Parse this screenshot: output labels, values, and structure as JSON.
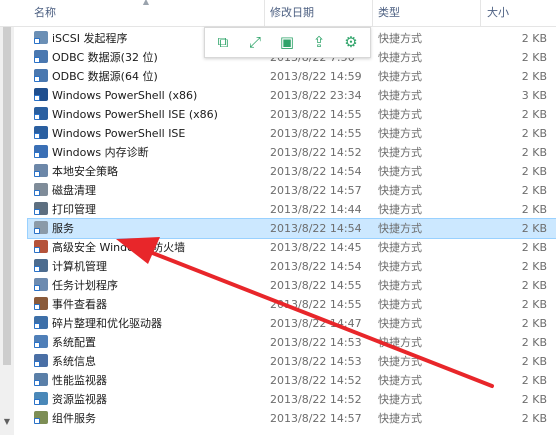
{
  "header": {
    "name_label": "名称",
    "date_label": "修改日期",
    "type_label": "类型",
    "size_label": "大小"
  },
  "toolbar": {
    "buttons": [
      {
        "name": "copy-icon",
        "glyph": "⧉"
      },
      {
        "name": "expand-icon",
        "glyph": "⤢"
      },
      {
        "name": "save-icon",
        "glyph": "▣"
      },
      {
        "name": "share-icon",
        "glyph": "⇪"
      },
      {
        "name": "gear-icon",
        "glyph": "⚙"
      }
    ]
  },
  "files": [
    {
      "name": "iSCSI 发起程序",
      "date": "",
      "type": "快捷方式",
      "size": "2 KB",
      "icon_color": "#6b8fb5",
      "selected": false
    },
    {
      "name": "ODBC 数据源(32 位)",
      "date": "2013/8/22 7:56",
      "type": "快捷方式",
      "size": "2 KB",
      "icon_color": "#4a78b0",
      "selected": false
    },
    {
      "name": "ODBC 数据源(64 位)",
      "date": "2013/8/22 14:59",
      "type": "快捷方式",
      "size": "2 KB",
      "icon_color": "#4a78b0",
      "selected": false
    },
    {
      "name": "Windows PowerShell (x86)",
      "date": "2013/8/22 23:34",
      "type": "快捷方式",
      "size": "3 KB",
      "icon_color": "#1f4f8f",
      "selected": false
    },
    {
      "name": "Windows PowerShell ISE (x86)",
      "date": "2013/8/22 14:55",
      "type": "快捷方式",
      "size": "2 KB",
      "icon_color": "#2a5fa0",
      "selected": false
    },
    {
      "name": "Windows PowerShell ISE",
      "date": "2013/8/22 14:55",
      "type": "快捷方式",
      "size": "2 KB",
      "icon_color": "#2a5fa0",
      "selected": false
    },
    {
      "name": "Windows 内存诊断",
      "date": "2013/8/22 14:52",
      "type": "快捷方式",
      "size": "2 KB",
      "icon_color": "#3a6fb5",
      "selected": false
    },
    {
      "name": "本地安全策略",
      "date": "2013/8/22 14:54",
      "type": "快捷方式",
      "size": "2 KB",
      "icon_color": "#6c87a8",
      "selected": false
    },
    {
      "name": "磁盘清理",
      "date": "2013/8/22 14:57",
      "type": "快捷方式",
      "size": "2 KB",
      "icon_color": "#7f8c99",
      "selected": false
    },
    {
      "name": "打印管理",
      "date": "2013/8/22 14:44",
      "type": "快捷方式",
      "size": "2 KB",
      "icon_color": "#5d6f80",
      "selected": false
    },
    {
      "name": "服务",
      "date": "2013/8/22 14:54",
      "type": "快捷方式",
      "size": "2 KB",
      "icon_color": "#8a9aa8",
      "selected": true
    },
    {
      "name": "高级安全 Windows 防火墙",
      "date": "2013/8/22 14:45",
      "type": "快捷方式",
      "size": "2 KB",
      "icon_color": "#b5533a",
      "selected": false
    },
    {
      "name": "计算机管理",
      "date": "2013/8/22 14:54",
      "type": "快捷方式",
      "size": "2 KB",
      "icon_color": "#4d6c8f",
      "selected": false
    },
    {
      "name": "任务计划程序",
      "date": "2013/8/22 14:55",
      "type": "快捷方式",
      "size": "2 KB",
      "icon_color": "#6d8bb0",
      "selected": false
    },
    {
      "name": "事件查看器",
      "date": "2013/8/22 14:55",
      "type": "快捷方式",
      "size": "2 KB",
      "icon_color": "#8a5a3a",
      "selected": false
    },
    {
      "name": "碎片整理和优化驱动器",
      "date": "2013/8/22 14:47",
      "type": "快捷方式",
      "size": "2 KB",
      "icon_color": "#3d6fa8",
      "selected": false
    },
    {
      "name": "系统配置",
      "date": "2013/8/22 14:53",
      "type": "快捷方式",
      "size": "2 KB",
      "icon_color": "#4f7fb8",
      "selected": false
    },
    {
      "name": "系统信息",
      "date": "2013/8/22 14:53",
      "type": "快捷方式",
      "size": "2 KB",
      "icon_color": "#4a6fa5",
      "selected": false
    },
    {
      "name": "性能监视器",
      "date": "2013/8/22 14:52",
      "type": "快捷方式",
      "size": "2 KB",
      "icon_color": "#5a7fa8",
      "selected": false
    },
    {
      "name": "资源监视器",
      "date": "2013/8/22 14:52",
      "type": "快捷方式",
      "size": "2 KB",
      "icon_color": "#4a88b8",
      "selected": false
    },
    {
      "name": "组件服务",
      "date": "2013/8/22 14:57",
      "type": "快捷方式",
      "size": "2 KB",
      "icon_color": "#7d8e55",
      "selected": false
    }
  ],
  "annotation": {
    "color": "#e8262a"
  },
  "colors": {
    "selection_bg": "#cce8ff",
    "toolbar_icon": "#2fa46a"
  }
}
